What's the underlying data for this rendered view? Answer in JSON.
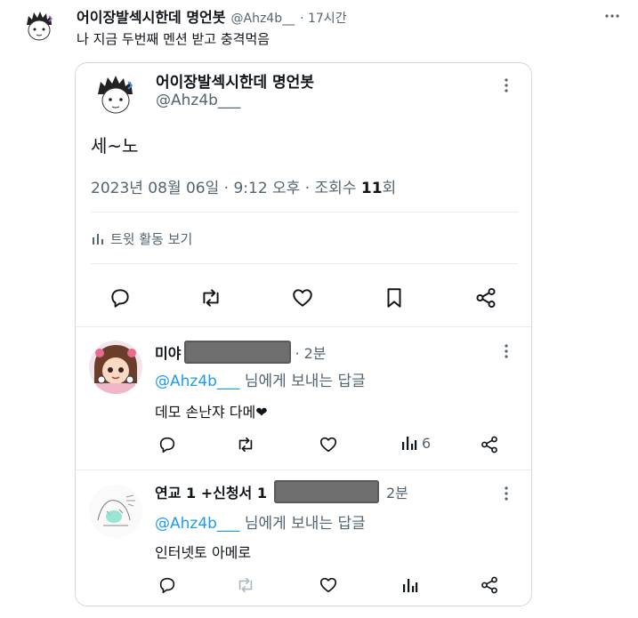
{
  "main_tweet": {
    "author_name": "어이장발섹시한데 명언봇",
    "handle": "@Ahz4b__",
    "time": "· 17시간",
    "text": "나 지금 두번째 멘션 받고 충격먹음"
  },
  "quoted_tweet": {
    "author_name": "어이장발섹시한데 명언봇",
    "handle": "@Ahz4b___",
    "text": "세~노",
    "timestamp": "2023년 08월 06일 · 9:12 오후 · 조회수 ",
    "views": "11",
    "views_suffix": "회",
    "activity_label": "트윗 활동 보기"
  },
  "replies": [
    {
      "author_name": "미야",
      "time": "· 2분",
      "reply_to_handle": "@Ahz4b___",
      "reply_to_suffix": "님에게 보내는 답글",
      "text": "데모 손난쟈 다메❤",
      "views": "6"
    },
    {
      "author_name": "연교 1 +신청서 1",
      "time": "2분",
      "reply_to_handle": "@Ahz4b___",
      "reply_to_suffix": "님에게 보내는 답글",
      "text": "인터넷토 아메로",
      "views": ""
    }
  ],
  "colors": {
    "text": "#0f1419",
    "secondary": "#536471",
    "link": "#1d9bf0",
    "border": "#cfd9de"
  }
}
